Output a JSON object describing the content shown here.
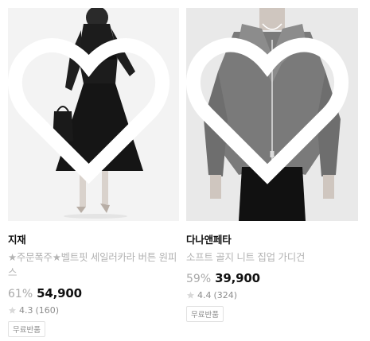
{
  "products": [
    {
      "brand": "지재",
      "name": "★주문폭주★벨트핏 세일러카라 버튼 원피스",
      "discount": "61%",
      "price": "54,900",
      "rating": "4.3",
      "reviews": "(160)",
      "tag": "무료반품"
    },
    {
      "brand": "다나앤페타",
      "name": "소프트 골지 니트 집업 가디건",
      "discount": "59%",
      "price": "39,900",
      "rating": "4.4",
      "reviews": "(324)",
      "tag": "무료반품"
    }
  ],
  "colors": {
    "text": "#111111",
    "muted": "#b3b3b3",
    "star": "#d9d9d9"
  },
  "icons": {
    "favorite": "heart-outline-icon",
    "rating": "star-icon"
  }
}
